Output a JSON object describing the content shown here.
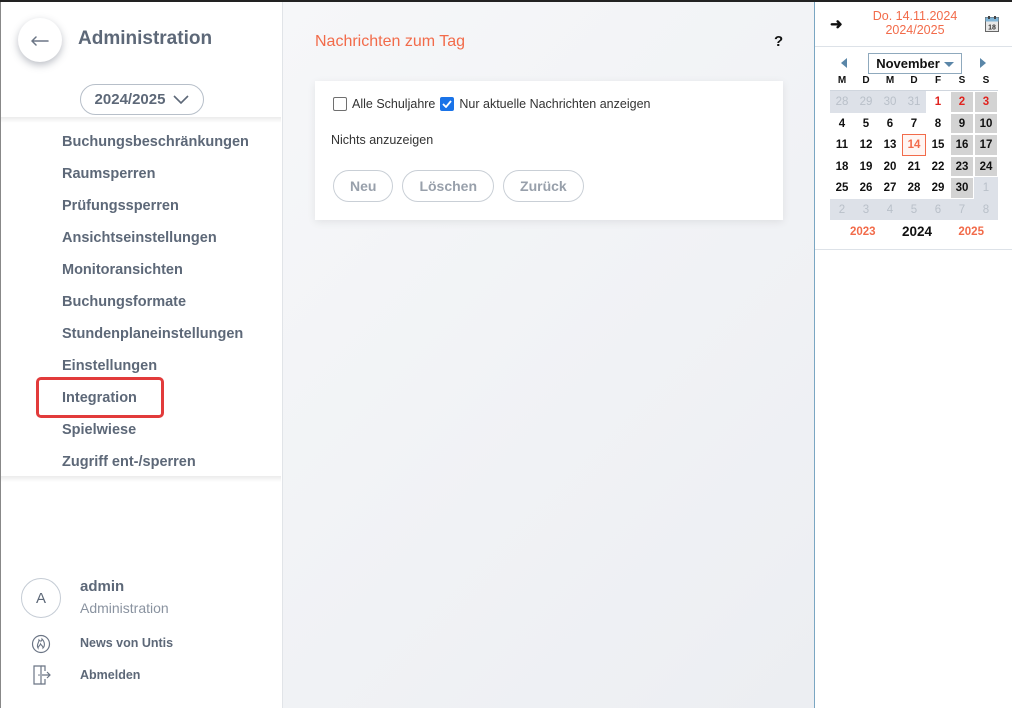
{
  "sidebar": {
    "title": "Administration",
    "school_year": "2024/2025",
    "items": [
      {
        "label": "Buchungsbeschränkungen"
      },
      {
        "label": "Raumsperren"
      },
      {
        "label": "Prüfungssperren"
      },
      {
        "label": "Ansichtseinstellungen"
      },
      {
        "label": "Monitoransichten"
      },
      {
        "label": "Buchungsformate"
      },
      {
        "label": "Stundenplaneinstellungen"
      },
      {
        "label": "Einstellungen"
      },
      {
        "label": "Integration"
      },
      {
        "label": "Spielwiese"
      },
      {
        "label": "Zugriff ent-/sperren"
      }
    ],
    "highlighted_item": "Integration",
    "user": {
      "initial": "A",
      "name": "admin",
      "role": "Administration"
    },
    "footer_links": [
      {
        "label": "News von Untis",
        "icon": "flame-icon"
      },
      {
        "label": "Abmelden",
        "icon": "logout-icon"
      }
    ]
  },
  "main": {
    "title": "Nachrichten zum Tag",
    "help": "?",
    "checkboxes": [
      {
        "label": "Alle Schuljahre",
        "checked": false
      },
      {
        "label": "Nur aktuelle Nachrichten anzeigen",
        "checked": true
      }
    ],
    "empty_message": "Nichts anzuzeigen",
    "buttons": {
      "new": "Neu",
      "delete": "Löschen",
      "back": "Zurück"
    }
  },
  "calendar": {
    "current_date": "Do. 14.11.2024",
    "school_year": "2024/2025",
    "month": "November",
    "weekday_headers": [
      "M",
      "D",
      "M",
      "D",
      "F",
      "S",
      "S"
    ],
    "weeks": [
      [
        "28",
        "29",
        "30",
        "31",
        "1",
        "2",
        "3"
      ],
      [
        "4",
        "5",
        "6",
        "7",
        "8",
        "9",
        "10"
      ],
      [
        "11",
        "12",
        "13",
        "14",
        "15",
        "16",
        "17"
      ],
      [
        "18",
        "19",
        "20",
        "21",
        "22",
        "23",
        "24"
      ],
      [
        "25",
        "26",
        "27",
        "28",
        "29",
        "30",
        "1"
      ],
      [
        "2",
        "3",
        "4",
        "5",
        "6",
        "7",
        "8"
      ]
    ],
    "today": "14",
    "holidays": [
      "1",
      "2",
      "3"
    ],
    "years": {
      "prev": "2023",
      "current": "2024",
      "next": "2025"
    },
    "colors": {
      "accent": "#f26b4a",
      "holiday": "#e0231f",
      "weekend": "#d3d3d3"
    }
  }
}
